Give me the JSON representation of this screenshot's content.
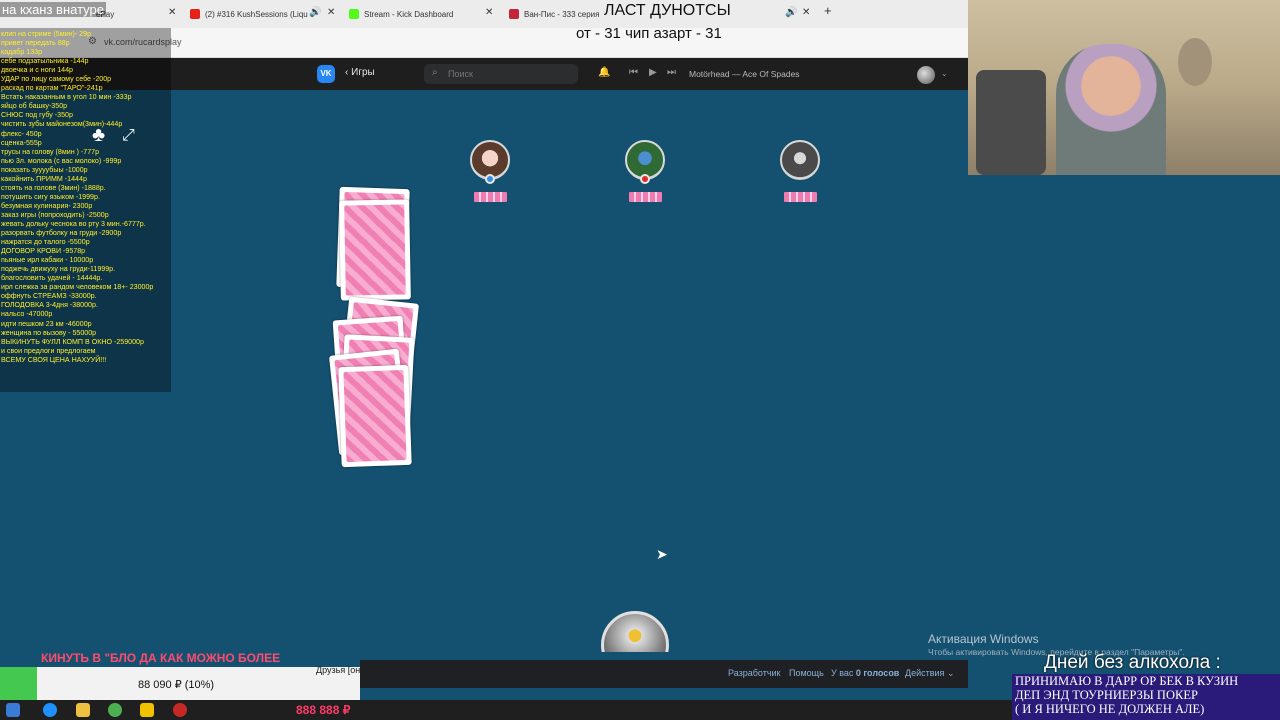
{
  "browser": {
    "tabs": [
      {
        "label": "ePay",
        "color": "#6b8f3a"
      },
      {
        "label": "(2) #316 KushSessions (Liqu",
        "color": "#e62117"
      },
      {
        "label": "Stream - Kick Dashboard",
        "color": "#53fc18"
      },
      {
        "label": "Ван-Пис - 333 серия",
        "color": "#c4243a"
      },
      {
        "label": "",
        "color": "#7f7f7f"
      }
    ],
    "url": "vk.com/rucardsplay",
    "new_tab_label": "+"
  },
  "vk": {
    "logo": "VK",
    "back_label": "Игры",
    "search_placeholder": "Поиск",
    "track": "Motörhead — Ace Of Spades",
    "footer": {
      "developer": "Разработчик",
      "help": "Помощь",
      "votes_prefix": "У вас",
      "votes_value": "0 голосов",
      "actions": "Действия"
    },
    "friends_online": "Друзья [онлайн]"
  },
  "game": {
    "players": [
      {
        "name": "player-1",
        "indicator_color": "#3a8fe0"
      },
      {
        "name": "player-2",
        "indicator_color": "#e32a2a"
      },
      {
        "name": "player-3",
        "indicator_color": ""
      }
    ],
    "card_back_color": "#f07fb4"
  },
  "stream": {
    "title": "на кханз внатуре",
    "last_donors": "ЛАСТ ДУНОТСЫ",
    "counter_line": "от - 31     чип азарт - 31",
    "donation_menu": [
      "клип на стриме (5мин)- 29р",
      "привет передать 88р",
      "кадабр 133р",
      "себе подзатыльника -144р",
      "двоечка и с ноги 144р",
      "УДАР по лицу самому себе -200р",
      "раскад по картам \"ТАРО\"-241р",
      "Встать наказанным в угол 10 мин -333р",
      "яйцо об башку-350р",
      "СНЮС под губу -350р",
      "чистить зубы майонезом(3мин)-444р",
      "флекс- 450р",
      "сценка-555р",
      "трусы на голову (8мин ) -777р",
      "пью 3л. молока (с вас молоко) -999р",
      "показать зуууубыы -1000р",
      "какойнить ПРИММ -1444р",
      "стоять на голове (3мин) -1888р.",
      "потушить сигу языком -1999р.",
      "безумная кулинария- 2300р",
      "заказ игры (попроходить) -2500р",
      "жевать дольку чеснока во рту 3 мин.-6777р.",
      "разорвать футболку на груди -2900р",
      "нажратся до талого -5500р",
      "ДОГОВОР КРОВИ -9578р",
      "пьяные ирл кабаки - 10000р",
      "поджечь движуху на груди-11999р.",
      "благословить удачей - 14444р.",
      "ирл слежка за рандом человеком 18+- 23000р",
      "оффнуть СТРЕАМЗ -33000р.",
      "ГОЛОДОВКА 3-4дня -38000р.",
      "нальсо -47000р",
      "идти пешком 23 км -46000р",
      "женщина по вызову - 55000р",
      "ВЫКИНУТЬ ФУЛЛ КОМП В ОКНО -259000р",
      "и свои предлоги предлогаем",
      "ВСЕМУ СВОЯ ЦЕНА НАХУУЙ!!!"
    ],
    "ticker": "КИНУТЬ В \"БЛО ДА КАК МОЖНО БОЛЕЕ",
    "goal_progress": "88 090 ₽ (10%)",
    "taskbar_money": "888 888 ₽",
    "days_label": "Дней без алкохола : ",
    "right_note": [
      "ПРИНИМАЮ В ДАРР ОР БЕК В КУЗИН",
      "ДЕП ЭНД ТОУРНИЕРЗЫ ПОКЕР",
      "( И Я НИЧЕГО НЕ ДОЛЖЕН АЛЕ)"
    ]
  },
  "windows": {
    "activation_title": "Активация Windows",
    "activation_sub": "Чтобы активировать Windows, перейдите в раздел \"Параметры\"."
  }
}
